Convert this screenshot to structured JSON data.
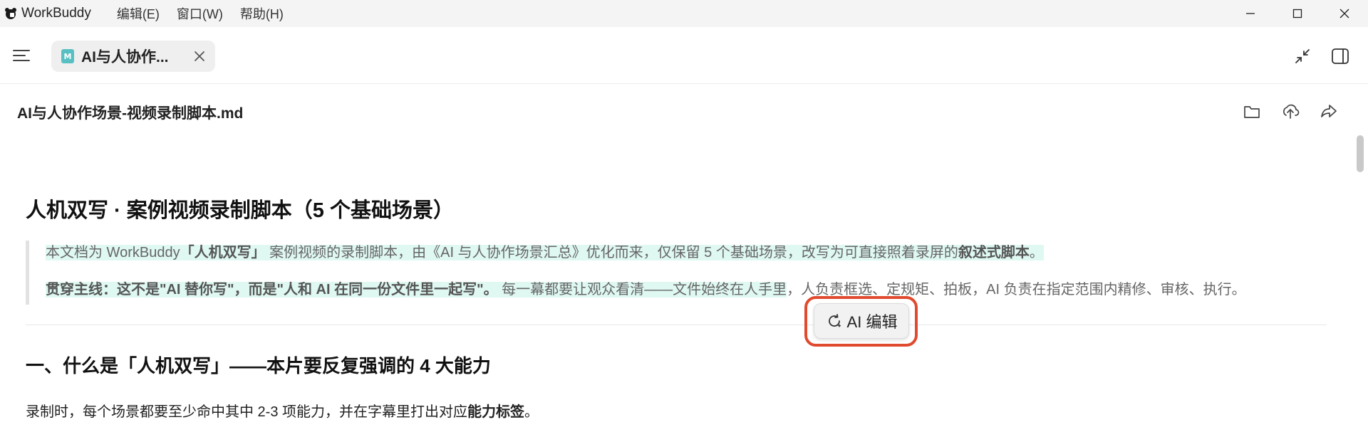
{
  "window": {
    "app_name": "WorkBuddy",
    "menu": [
      "编辑(E)",
      "窗口(W)",
      "帮助(H)"
    ]
  },
  "tab": {
    "icon_letter": "M",
    "title": "AI与人协作..."
  },
  "file": {
    "name": "AI与人协作场景-视频录制脚本.md"
  },
  "doc": {
    "h1": "人机双写 · 案例视频录制脚本（5 个基础场景）",
    "quote": {
      "line1_a": "本文档为 WorkBuddy",
      "line1_b": "「人机双写」",
      "line1_c": " 案例视频的录制脚本，由《AI 与人协作场景汇总》优化而来，仅保留 5 个基础场景，改写为可直接照着录屏的",
      "line1_d": "叙述式脚本",
      "line1_e": "。",
      "line2_a": "贯穿主线：这不是\"AI 替你写\"，而是\"人和 AI 在同一份文件里一起写\"。",
      "line2_b": " 每一幕都要让观众看清——文件始终在人手里",
      "line2_c": "，人负责框选、定规矩、拍板，AI 负责在指定范围内精修、审核、执行。"
    },
    "h2": "一、什么是「人机双写」——本片要反复强调的 4 大能力",
    "para_a": "录制时，每个场景都要至少命中其中 2-3 项能力，并在字幕里打出对应",
    "para_b": "能力标签",
    "para_c": "。"
  },
  "ai_edit": {
    "label": "AI 编辑",
    "icon": "refresh-sparkle-icon"
  },
  "colors": {
    "highlight": "#dff8f2",
    "ring": "#e04a2f",
    "tab_icon": "#58c0c3"
  }
}
